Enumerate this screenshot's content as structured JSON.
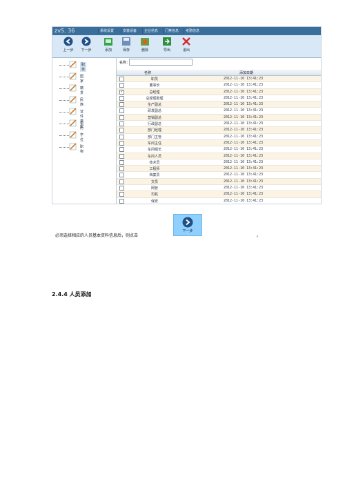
{
  "app": {
    "title": "zvS. 36"
  },
  "menu": [
    "系统设置",
    "安装设备",
    "企业信息",
    "门禁信息",
    "考勤信息"
  ],
  "toolbar": [
    "上一步",
    "下一步",
    "添加",
    "保存",
    "删除",
    "导出",
    "退出"
  ],
  "sidebar": [
    "职务",
    "国家",
    "籍贯",
    "民族",
    "证件类型",
    "学历",
    "学位",
    "职称"
  ],
  "search": {
    "label": "名称：",
    "value": ""
  },
  "table": {
    "headers": [
      "名称",
      "添加日期"
    ],
    "rows": [
      {
        "name": "职员",
        "date": "2012-11-10 13:41:23",
        "checked": false
      },
      {
        "name": "董事长",
        "date": "2012-11-10 13:41:23",
        "checked": false
      },
      {
        "name": "总经理",
        "date": "2012-11-10 13:41:23",
        "checked": true
      },
      {
        "name": "总经理助理",
        "date": "2012-11-10 13:41:23",
        "checked": false
      },
      {
        "name": "生产副总",
        "date": "2012-11-10 13:41:23",
        "checked": false
      },
      {
        "name": "研发副总",
        "date": "2012-11-10 13:41:23",
        "checked": false
      },
      {
        "name": "营销副总",
        "date": "2012-11-10 13:41:23",
        "checked": false
      },
      {
        "name": "行政副总",
        "date": "2012-11-10 13:41:23",
        "checked": false
      },
      {
        "name": "部门经理",
        "date": "2012-11-10 13:41:23",
        "checked": false
      },
      {
        "name": "部门主管",
        "date": "2012-11-10 13:41:23",
        "checked": false
      },
      {
        "name": "车间主任",
        "date": "2012-11-10 13:41:23",
        "checked": false
      },
      {
        "name": "车间组长",
        "date": "2012-11-10 13:41:23",
        "checked": false
      },
      {
        "name": "车间人员",
        "date": "2012-11-10 13:41:23",
        "checked": false
      },
      {
        "name": "技术员",
        "date": "2012-11-10 13:41:23",
        "checked": false
      },
      {
        "name": "工程师",
        "date": "2012-11-10 13:41:23",
        "checked": false
      },
      {
        "name": "档案员",
        "date": "2012-11-10 13:41:23",
        "checked": false
      },
      {
        "name": "文员",
        "date": "2012-11-10 13:41:23",
        "checked": false
      },
      {
        "name": "网管",
        "date": "2012-11-10 13:41:23",
        "checked": false
      },
      {
        "name": "司机",
        "date": "2012-11-10 13:41:23",
        "checked": false
      },
      {
        "name": "保安",
        "date": "2012-11-10 13:41:23",
        "checked": false
      }
    ]
  },
  "doc": {
    "instruction": "必须选择相应的人员基本资料信息后，则点击",
    "instruction_end": "。",
    "next_button": "下一步",
    "section_heading": "2.4.4  人员添加"
  }
}
